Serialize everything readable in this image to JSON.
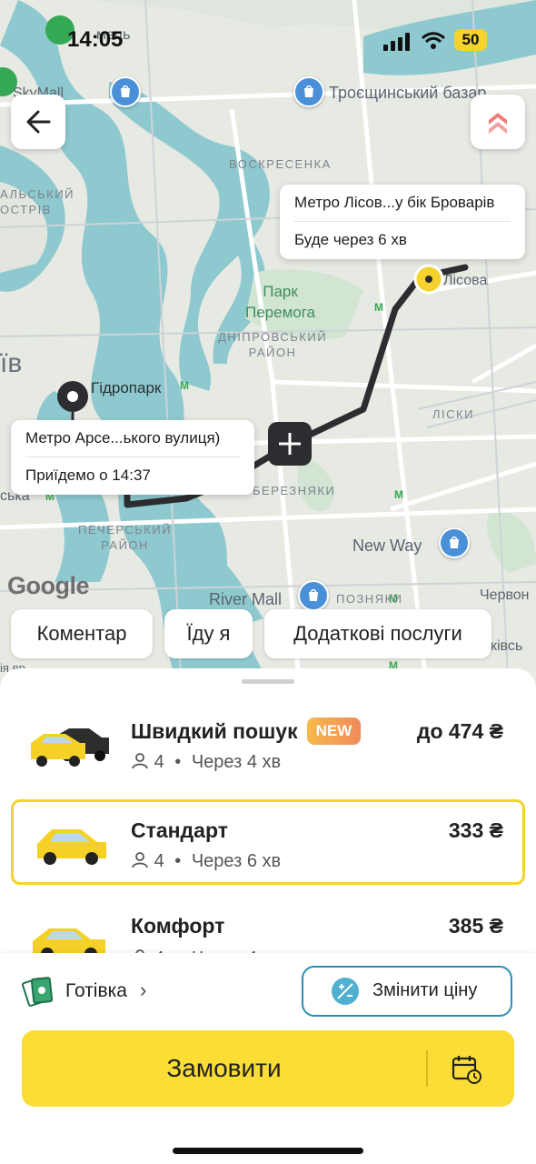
{
  "status_bar": {
    "time": "14:05",
    "battery": "50"
  },
  "map": {
    "labels": {
      "troieshchyna_market": "Троєщинський базар",
      "skymall": "SkyMall",
      "voskresenka": "ВОСКРЕСЕНКА",
      "park": "Парк\nПеремога",
      "dniprovskyi": "ДНІПРОВСЬКИЙ\nРАЙОН",
      "hidropark": "Гідропарк",
      "lisova": "Лісова",
      "lisky": "ЛІСКИ",
      "bereznyaky": "БЕРЕЗНЯКИ",
      "pecherskyi": "ПЕЧЕРСЬКИЙ\nРАЙОН",
      "new_way": "New Way",
      "river_mall": "River Mall",
      "pozniaky": "ПОЗНЯКИ",
      "chervon": "Червон",
      "kyiv_partial": "ïв",
      "google": "Google",
      "partial_top": "мець",
      "partial_ostriv": "АЛЬСЬКИЙ\nОСТРІВ",
      "partial_ska": "ська",
      "partial_yar": "ія яр",
      "partial_brovary": "ківсь"
    },
    "pickup_tooltip": {
      "title": "Метро Арсе...ького вулиця)",
      "eta": "Приїдемо о 14:37"
    },
    "destination_tooltip": {
      "title": "Метро Лісов...у бік Броварів",
      "eta": "Буде через 6 хв"
    }
  },
  "chips": {
    "comment": "Коментар",
    "going_myself": "Їду я",
    "extra_services": "Додаткові послуги"
  },
  "tariffs": [
    {
      "name": "Швидкий пошук",
      "badge": "NEW",
      "price": "до 474 ₴",
      "seats": "4",
      "eta": "Через 4 хв",
      "selected": false
    },
    {
      "name": "Стандарт",
      "price": "333 ₴",
      "seats": "4",
      "eta": "Через 6 хв",
      "selected": true
    },
    {
      "name": "Комфорт",
      "price": "385 ₴",
      "seats": "4",
      "eta": "Через 4 хв",
      "selected": false
    }
  ],
  "footer": {
    "payment": "Готівка",
    "change_price": "Змінити ціну",
    "order": "Замовити"
  },
  "colors": {
    "accent": "#fbdd35",
    "route": "#2b2d30",
    "water": "#8ec9cf",
    "pin": "#f6d32c"
  }
}
